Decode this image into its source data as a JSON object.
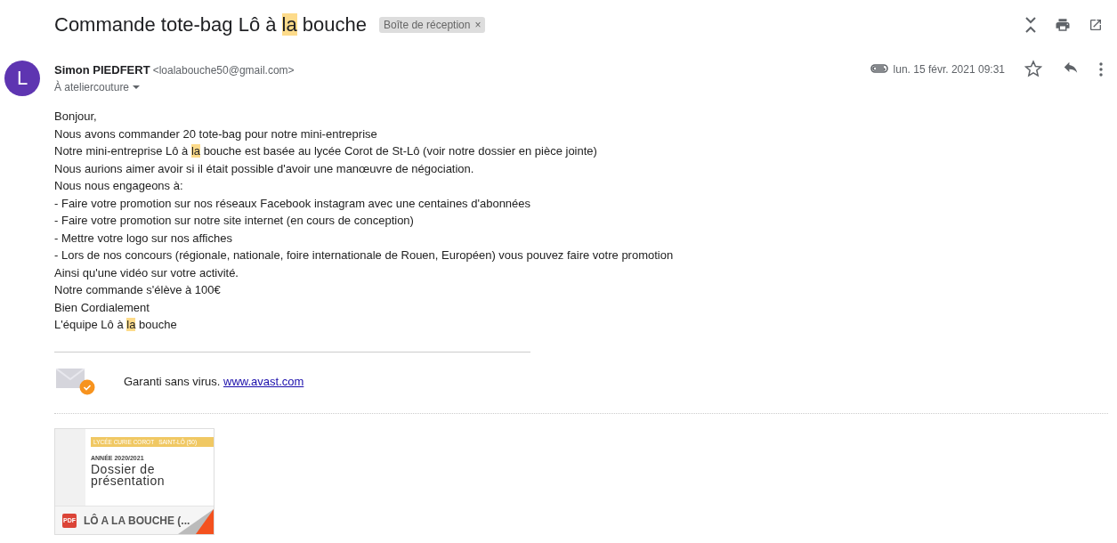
{
  "subject": [
    {
      "text": "Commande tote-bag Lô à ",
      "highlight": false
    },
    {
      "text": "la",
      "highlight": true
    },
    {
      "text": " bouche",
      "highlight": false
    }
  ],
  "label": {
    "text": "Boîte de réception",
    "close": "×"
  },
  "sender": {
    "avatar": "L",
    "name": "Simon PIEDFERT",
    "email": "<loalabouche50@gmail.com>",
    "to": "À ateliercouture",
    "date": "lun. 15 févr. 2021 09:31",
    "has_attachment": true,
    "starred": false
  },
  "body": [
    [
      {
        "text": "Bonjour,",
        "highlight": false
      }
    ],
    [
      {
        "text": "Nous avons commander 20 tote-bag pour notre mini-entreprise",
        "highlight": false
      }
    ],
    [
      {
        "text": "Notre mini-entreprise Lô à ",
        "highlight": false
      },
      {
        "text": "la",
        "highlight": true
      },
      {
        "text": " bouche est basée au lycée Corot de St-Lô (voir notre dossier en pièce jointe)",
        "highlight": false
      }
    ],
    [
      {
        "text": "Nous aurions aimer avoir si il était possible d'avoir une manœuvre de négociation.",
        "highlight": false
      }
    ],
    [
      {
        "text": "Nous nous engageons à:",
        "highlight": false
      }
    ],
    [
      {
        "text": "- Faire votre promotion sur nos réseaux Facebook instagram avec une centaines d'abonnées",
        "highlight": false
      }
    ],
    [
      {
        "text": "- Faire votre promotion sur notre site internet (en cours de conception)",
        "highlight": false
      }
    ],
    [
      {
        "text": "- Mettre votre logo sur nos affiches",
        "highlight": false
      }
    ],
    [
      {
        "text": "- Lors de nos concours (régionale, nationale, foire internationale de Rouen, Européen) vous pouvez faire votre promotion",
        "highlight": false
      }
    ],
    [
      {
        "text": "Ainsi qu'une vidéo sur votre activité.",
        "highlight": false
      }
    ],
    [
      {
        "text": "Notre commande s'élève à 100€",
        "highlight": false
      }
    ],
    [
      {
        "text": "Bien Cordialement",
        "highlight": false
      }
    ],
    [
      {
        "text": "L'équipe Lô à ",
        "highlight": false
      },
      {
        "text": "la",
        "highlight": true
      },
      {
        "text": " bouche",
        "highlight": false
      }
    ]
  ],
  "signature": {
    "text": "Garanti sans virus.",
    "link": "www.avast.com"
  },
  "attachment": {
    "band": [
      "LYCÉE CURIE COROT",
      "SAINT-LÔ (50)"
    ],
    "year": "ANNÉE 2020/2021",
    "title": "Dossier de présentation",
    "type": "PDF",
    "name": "LÔ A LA BOUCHE (..."
  }
}
